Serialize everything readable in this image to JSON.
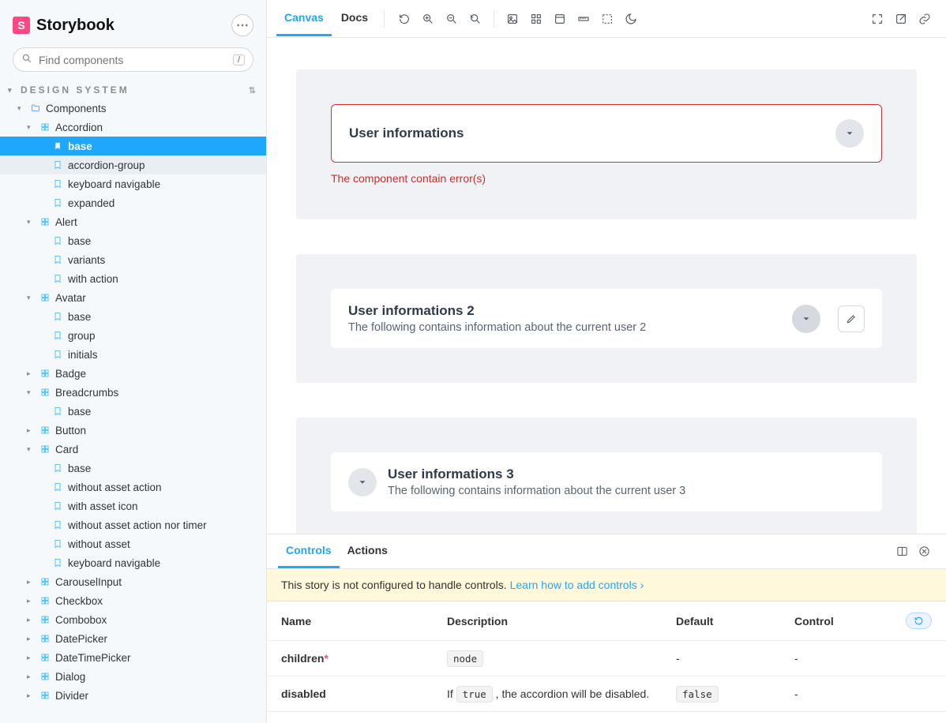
{
  "brand": {
    "logo_letter": "S",
    "name": "Storybook"
  },
  "search": {
    "placeholder": "Find components",
    "shortcut": "/"
  },
  "section": {
    "title": "DESIGN SYSTEM"
  },
  "tree": [
    {
      "depth": 0,
      "kind": "folder",
      "expand": "open",
      "label": "Components"
    },
    {
      "depth": 1,
      "kind": "comp",
      "expand": "open",
      "label": "Accordion"
    },
    {
      "depth": 2,
      "kind": "story",
      "expand": "",
      "label": "base",
      "selected": true
    },
    {
      "depth": 2,
      "kind": "story",
      "expand": "",
      "label": "accordion-group",
      "hover": true
    },
    {
      "depth": 2,
      "kind": "story",
      "expand": "",
      "label": "keyboard navigable"
    },
    {
      "depth": 2,
      "kind": "story",
      "expand": "",
      "label": "expanded"
    },
    {
      "depth": 1,
      "kind": "comp",
      "expand": "open",
      "label": "Alert"
    },
    {
      "depth": 2,
      "kind": "story",
      "expand": "",
      "label": "base"
    },
    {
      "depth": 2,
      "kind": "story",
      "expand": "",
      "label": "variants"
    },
    {
      "depth": 2,
      "kind": "story",
      "expand": "",
      "label": "with action"
    },
    {
      "depth": 1,
      "kind": "comp",
      "expand": "open",
      "label": "Avatar"
    },
    {
      "depth": 2,
      "kind": "story",
      "expand": "",
      "label": "base"
    },
    {
      "depth": 2,
      "kind": "story",
      "expand": "",
      "label": "group"
    },
    {
      "depth": 2,
      "kind": "story",
      "expand": "",
      "label": "initials"
    },
    {
      "depth": 1,
      "kind": "comp",
      "expand": "closed",
      "label": "Badge"
    },
    {
      "depth": 1,
      "kind": "comp",
      "expand": "open",
      "label": "Breadcrumbs"
    },
    {
      "depth": 2,
      "kind": "story",
      "expand": "",
      "label": "base"
    },
    {
      "depth": 1,
      "kind": "comp",
      "expand": "closed",
      "label": "Button"
    },
    {
      "depth": 1,
      "kind": "comp",
      "expand": "open",
      "label": "Card"
    },
    {
      "depth": 2,
      "kind": "story",
      "expand": "",
      "label": "base"
    },
    {
      "depth": 2,
      "kind": "story",
      "expand": "",
      "label": "without asset action"
    },
    {
      "depth": 2,
      "kind": "story",
      "expand": "",
      "label": "with asset icon"
    },
    {
      "depth": 2,
      "kind": "story",
      "expand": "",
      "label": "without asset action nor timer"
    },
    {
      "depth": 2,
      "kind": "story",
      "expand": "",
      "label": "without asset"
    },
    {
      "depth": 2,
      "kind": "story",
      "expand": "",
      "label": "keyboard navigable"
    },
    {
      "depth": 1,
      "kind": "comp",
      "expand": "closed",
      "label": "CarouselInput"
    },
    {
      "depth": 1,
      "kind": "comp",
      "expand": "closed",
      "label": "Checkbox"
    },
    {
      "depth": 1,
      "kind": "comp",
      "expand": "closed",
      "label": "Combobox"
    },
    {
      "depth": 1,
      "kind": "comp",
      "expand": "closed",
      "label": "DatePicker"
    },
    {
      "depth": 1,
      "kind": "comp",
      "expand": "closed",
      "label": "DateTimePicker"
    },
    {
      "depth": 1,
      "kind": "comp",
      "expand": "closed",
      "label": "Dialog"
    },
    {
      "depth": 1,
      "kind": "comp",
      "expand": "closed",
      "label": "Divider"
    }
  ],
  "toolbar": {
    "tabs": {
      "canvas": "Canvas",
      "docs": "Docs"
    },
    "tools": [
      "refresh-icon",
      "zoom-in-icon",
      "zoom-out-icon",
      "zoom-reset-icon",
      "background-icon",
      "grid-icon",
      "dock-icon",
      "ruler-icon",
      "outline-icon",
      "theme-icon"
    ],
    "right_tools": [
      "fullscreen-icon",
      "open-new-icon",
      "link-icon"
    ]
  },
  "canvas": {
    "cards": [
      {
        "title": "User informations",
        "error": "The component contain error(s)"
      },
      {
        "title": "User informations 2",
        "subtitle": "The following contains information about the current user 2",
        "editable": true
      },
      {
        "title": "User informations 3",
        "subtitle": "The following contains information about the current user 3",
        "chevLeft": true
      }
    ]
  },
  "addons": {
    "tabs": {
      "controls": "Controls",
      "actions": "Actions"
    },
    "notice_text": "This story is not configured to handle controls. ",
    "notice_link": "Learn how to add controls",
    "columns": {
      "name": "Name",
      "desc": "Description",
      "def": "Default",
      "ctrl": "Control"
    },
    "rows": [
      {
        "name": "children",
        "required": true,
        "desc_code": "node",
        "desc_text": "",
        "def": "-",
        "ctrl": "-"
      },
      {
        "name": "disabled",
        "required": false,
        "desc_pre": "If ",
        "desc_code": "true",
        "desc_post": " , the accordion will be disabled.",
        "def_code": "false",
        "ctrl": "-"
      }
    ]
  }
}
